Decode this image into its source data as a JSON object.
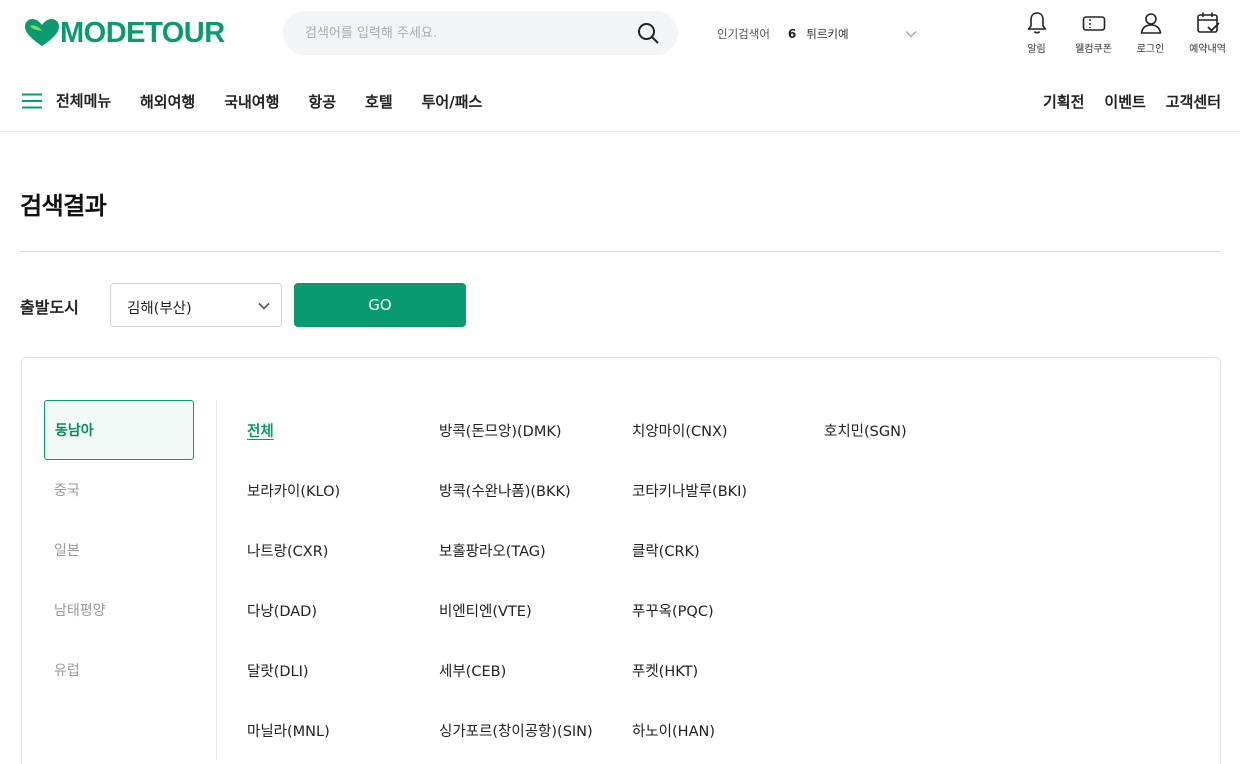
{
  "brand": {
    "name": "MODETOUR",
    "color": "#0a9a6f"
  },
  "search": {
    "placeholder": "검색어를 입력해 주세요.",
    "value": ""
  },
  "popular": {
    "label": "인기검색어",
    "rank": "6",
    "term": "튀르키예"
  },
  "util": [
    {
      "label": "알림",
      "icon": "bell-icon"
    },
    {
      "label": "웰컴쿠폰",
      "icon": "ticket-icon"
    },
    {
      "label": "로그인",
      "icon": "user-icon"
    },
    {
      "label": "예약내역",
      "icon": "calendar-check-icon"
    }
  ],
  "gnb": {
    "all_menu": "전체메뉴",
    "links": [
      "해외여행",
      "국내여행",
      "항공",
      "호텔",
      "투어/패스"
    ],
    "right_links": [
      "기획전",
      "이벤트",
      "고객센터"
    ]
  },
  "page": {
    "title": "검색결과"
  },
  "departure": {
    "label": "출발도시",
    "selected": "김해(부산)",
    "go_label": "GO"
  },
  "regions": [
    {
      "label": "동남아",
      "active": true
    },
    {
      "label": "중국",
      "active": false
    },
    {
      "label": "일본",
      "active": false
    },
    {
      "label": "남태평양",
      "active": false
    },
    {
      "label": "유럽",
      "active": false
    }
  ],
  "cities": [
    "전체",
    "방콕(돈므앙)(DMK)",
    "치앙마이(CNX)",
    "호치민(SGN)",
    "보라카이(KLO)",
    "방콕(수완나폼)(BKK)",
    "코타키나발루(BKI)",
    "",
    "나트랑(CXR)",
    "보홀팡라오(TAG)",
    "클락(CRK)",
    "",
    "다낭(DAD)",
    "비엔티엔(VTE)",
    "푸꾸옥(PQC)",
    "",
    "달랏(DLI)",
    "세부(CEB)",
    "푸켓(HKT)",
    "",
    "마닐라(MNL)",
    "싱가포르(창이공항)(SIN)",
    "하노이(HAN)",
    ""
  ],
  "selected_city": "전체"
}
